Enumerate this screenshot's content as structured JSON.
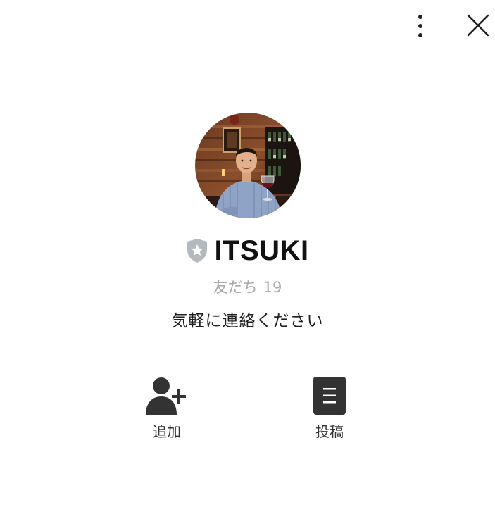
{
  "header": {
    "more_icon": "vertical-ellipsis-icon",
    "close_icon": "close-x-icon"
  },
  "profile": {
    "name": "ITSUKI",
    "badge_icon": "verified-shield-star-icon",
    "badge_color": "#b4b9bf",
    "friends_label": "友だち",
    "friends_count": "19",
    "status_message": "気軽に連絡ください"
  },
  "actions": [
    {
      "label": "追加",
      "icon": "add-friend-icon"
    },
    {
      "label": "投稿",
      "icon": "post-document-icon"
    }
  ],
  "colors": {
    "text_primary": "#111111",
    "text_muted": "#a8a8a8",
    "icon_dark": "#333333"
  }
}
